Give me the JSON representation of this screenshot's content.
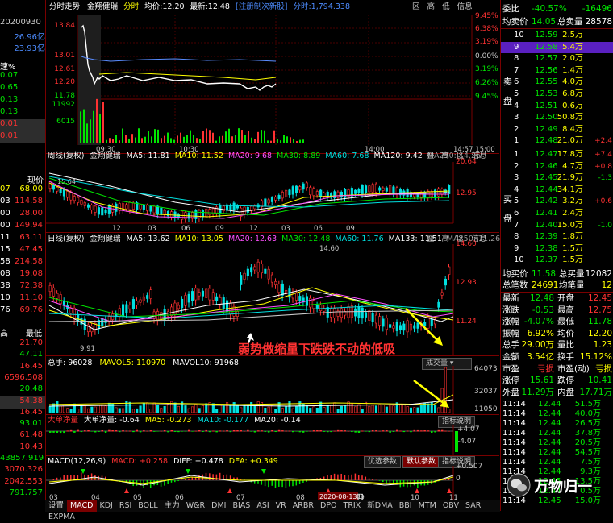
{
  "left_column": {
    "top_code": "20200930",
    "val1": "26.96亿",
    "val2": "23.93亿",
    "speed_label": "速%",
    "speed_values": [
      "0.07",
      "0.65",
      "0.13",
      "0.13",
      "0.01",
      "0.01"
    ],
    "list_header": "现价",
    "list_values": [
      "68.00",
      "114.58",
      "28.00",
      "149.94",
      "63.11",
      "47.45",
      "214.58",
      "19.08",
      "72.38",
      "11.10",
      "69.76"
    ],
    "list_left": [
      "07",
      "03",
      "00",
      "00",
      "11",
      "15",
      "58",
      "08",
      "38",
      "10",
      "76"
    ],
    "low_header_a": "高",
    "low_header_b": "最低",
    "low_values": [
      "21.70",
      "47.11",
      "16.45",
      "6596.508",
      "20.48",
      "54.38",
      "16.45",
      "93.01",
      "61.48",
      "10.43",
      "43857.919",
      "3070.326",
      "2042.553",
      "791.757"
    ]
  },
  "intraday": {
    "title": "分时走势",
    "name": "金翔健瑞",
    "label_fen": "分时",
    "jun_label": "均价:",
    "jun_value": "12.20",
    "latest_label": "最新:",
    "latest_value": "12.48",
    "notice": "[注册制次新股]",
    "fenshi_label": "分时:",
    "fenshi_value": "1,794.338",
    "buttons": [
      "区",
      "高",
      "低",
      "信息"
    ],
    "y_left": [
      "13.84",
      "13.01",
      "12.61",
      "12.20",
      "11.78",
      "11992",
      "6015"
    ],
    "y_right": [
      "9.45%",
      "6.38%",
      "3.19%",
      "0.00%",
      "3.19%",
      "6.26%",
      "9.45%"
    ],
    "x_ticks": [
      "09:30",
      "10:30",
      "14:00",
      "14:57 15:00"
    ]
  },
  "weekly": {
    "title": "周线(复权)",
    "name": "金翔健瑞",
    "ma5": "MA5: 11.81",
    "ma10": "MA10: 11.52",
    "ma20": "MA20: 9.68",
    "ma30": "MA30: 8.89",
    "ma60": "MA60: 7.68",
    "ma120": "MA120: 9.42",
    "ma250": "MA250: 14.26",
    "buttons": [
      "叠",
      "高",
      "区",
      "信息"
    ],
    "y_right": [
      "20.64",
      "12.95"
    ],
    "hi_label": "15.64",
    "x_ticks": [
      "12",
      "03",
      "06",
      "09",
      "12",
      "03",
      "06",
      "09"
    ]
  },
  "daily": {
    "title": "日线(复权)",
    "name": "金翔健瑞",
    "ma5": "MA5: 13.62",
    "ma10": "MA10: 13.05",
    "ma20": "MA20: 12.63",
    "ma30": "MA30: 12.48",
    "ma60": "MA60: 11.76",
    "ma133": "MA133: 11.51",
    "ma250": "MA250: 11.26",
    "buttons": [
      "叠",
      "高",
      "区",
      "信息"
    ],
    "y_right": [
      "14.60",
      "12.93",
      "11.24"
    ],
    "hi_label": "14.60",
    "lo_label": "9.91",
    "annotation": "弱势做缩量下跌跌不动的低吸"
  },
  "volume": {
    "label": "总手: 96028",
    "mavol5": "MAVOL5: 110970",
    "mavol10": "MAVOL10: 91968",
    "button": "成交量",
    "y_right": [
      "64073",
      "32037",
      "11050"
    ]
  },
  "netflow": {
    "label": "大单净量",
    "sub": "大单净量: -0.64",
    "ma5": "MA5: -0.273",
    "ma10": "MA10: -0.177",
    "ma20": "MA20: -0.14",
    "button": "指标说明",
    "y_right": [
      "+4.07",
      "-4.07"
    ]
  },
  "macd": {
    "label": "MACD(12,26,9)",
    "macd": "MACD: +0.258",
    "diff": "DIFF: +0.478",
    "dea": "DEA: +0.349",
    "btn1": "优选参数",
    "btn2": "默认参数",
    "btn3": "指标说明",
    "y_right": [
      "+0.507",
      "0"
    ],
    "x_ticks": [
      "03",
      "04",
      "05",
      "06",
      "07",
      "08",
      "09",
      "10",
      "11"
    ],
    "date_label": "2020-08-13四"
  },
  "tabs": [
    "设置",
    "MACD",
    "KDJ",
    "RSI",
    "BOLL",
    "主力",
    "W&R",
    "DMI",
    "BIAS",
    "ASI",
    "VR",
    "ARBR",
    "DPO",
    "TRIX",
    "新DMA",
    "BBI",
    "MTM",
    "OBV",
    "SAR",
    "EXPMA"
  ],
  "active_tab": "MACD",
  "orderbook": {
    "weibi_label": "委比",
    "weibi_value": "-40.57%",
    "weicha_value": "-16496",
    "junmai_label": "均卖价",
    "junmai_value": "14.05",
    "zongmai_label": "总卖量",
    "zongmai_value": "28578",
    "sell_side_label": "卖盘",
    "buy_side_label": "买盘",
    "sell": [
      {
        "level": "10",
        "price": "12.59",
        "vol": "2.5万",
        "chg": ""
      },
      {
        "level": "9",
        "price": "12.58",
        "vol": "5.4万",
        "chg": ""
      },
      {
        "level": "8",
        "price": "12.57",
        "vol": "2.0万",
        "chg": ""
      },
      {
        "level": "7",
        "price": "12.56",
        "vol": "1.4万",
        "chg": ""
      },
      {
        "level": "6",
        "price": "12.55",
        "vol": "4.0万",
        "chg": ""
      },
      {
        "level": "5",
        "price": "12.53",
        "vol": "6.8万",
        "chg": ""
      },
      {
        "level": "4",
        "price": "12.51",
        "vol": "0.6万",
        "chg": ""
      },
      {
        "level": "3",
        "price": "12.50",
        "vol": "50.8万",
        "chg": ""
      },
      {
        "level": "2",
        "price": "12.49",
        "vol": "8.4万",
        "chg": ""
      },
      {
        "level": "1",
        "price": "12.48",
        "vol": "21.0万",
        "chg": "+2.4"
      }
    ],
    "buy": [
      {
        "level": "1",
        "price": "12.47",
        "vol": "17.8万",
        "chg": "+7.4"
      },
      {
        "level": "2",
        "price": "12.46",
        "vol": "4.7万",
        "chg": "+0.8"
      },
      {
        "level": "3",
        "price": "12.45",
        "vol": "21.9万",
        "chg": "-1.3"
      },
      {
        "level": "4",
        "price": "12.44",
        "vol": "34.1万",
        "chg": ""
      },
      {
        "level": "5",
        "price": "12.42",
        "vol": "3.2万",
        "chg": "+0.6"
      },
      {
        "level": "6",
        "price": "12.41",
        "vol": "2.4万",
        "chg": ""
      },
      {
        "level": "7",
        "price": "12.40",
        "vol": "15.0万",
        "chg": "-1.0"
      },
      {
        "level": "8",
        "price": "12.39",
        "vol": "1.8万",
        "chg": ""
      },
      {
        "level": "9",
        "price": "12.38",
        "vol": "1.5万",
        "chg": ""
      },
      {
        "level": "10",
        "price": "12.37",
        "vol": "1.5万",
        "chg": ""
      }
    ],
    "junmai_b_label": "均买价",
    "junmai_b_value": "11.58",
    "zongmai_b_label": "总买量",
    "zongmai_b_value": "12082",
    "zongbi_label": "总笔数",
    "zongbi_value": "24691",
    "junbi_label": "均笔量",
    "junbi_value": "12"
  },
  "stats": [
    {
      "l1": "最新",
      "v1": "12.48",
      "l2": "开盘",
      "v2": "12.45"
    },
    {
      "l1": "涨跌",
      "v1": "-0.53",
      "l2": "最高",
      "v2": "12.75"
    },
    {
      "l1": "涨幅",
      "v1": "-4.07%",
      "l2": "最低",
      "v2": "11.78"
    },
    {
      "l1": "振幅",
      "v1": "6.92%",
      "l2": "均价",
      "v2": "12.20"
    },
    {
      "l1": "总手",
      "v1": "29.00万",
      "l2": "量比",
      "v2": "1.23"
    },
    {
      "l1": "金额",
      "v1": "3.54亿",
      "l2": "换手",
      "v2": "15.12%"
    },
    {
      "l1": "市盈",
      "v1": "亏损",
      "l2": "市盈(动)",
      "v2": "亏损"
    },
    {
      "l1": "涨停",
      "v1": "15.61",
      "l2": "跌停",
      "v2": "10.41"
    },
    {
      "l1": "外盘",
      "v1": "11.29万",
      "l2": "内盘",
      "v2": "17.71万"
    }
  ],
  "ticks": [
    {
      "t": "11:14",
      "p": "12.44",
      "v": "51.5万"
    },
    {
      "t": "11:14",
      "p": "12.44",
      "v": "40.0万"
    },
    {
      "t": "11:14",
      "p": "12.44",
      "v": "26.5万"
    },
    {
      "t": "11:14",
      "p": "12.44",
      "v": "37.8万"
    },
    {
      "t": "11:14",
      "p": "12.44",
      "v": "20.5万"
    },
    {
      "t": "11:14",
      "p": "12.44",
      "v": "54.5万"
    },
    {
      "t": "11:14",
      "p": "12.44",
      "v": "7.5万"
    },
    {
      "t": "11:14",
      "p": "12.44",
      "v": "9.3万"
    },
    {
      "t": "11:14",
      "p": "12.45",
      "v": "13.5万"
    },
    {
      "t": "11:14",
      "p": "12.44",
      "v": "0.5万"
    },
    {
      "t": "11:14",
      "p": "12.45",
      "v": "15.0万"
    }
  ],
  "watermark": "万物归一",
  "colors": {
    "up": "#ff3232",
    "down": "#00e600",
    "border": "#7a0000",
    "bg": "#000000",
    "select": "#5a20c0"
  }
}
